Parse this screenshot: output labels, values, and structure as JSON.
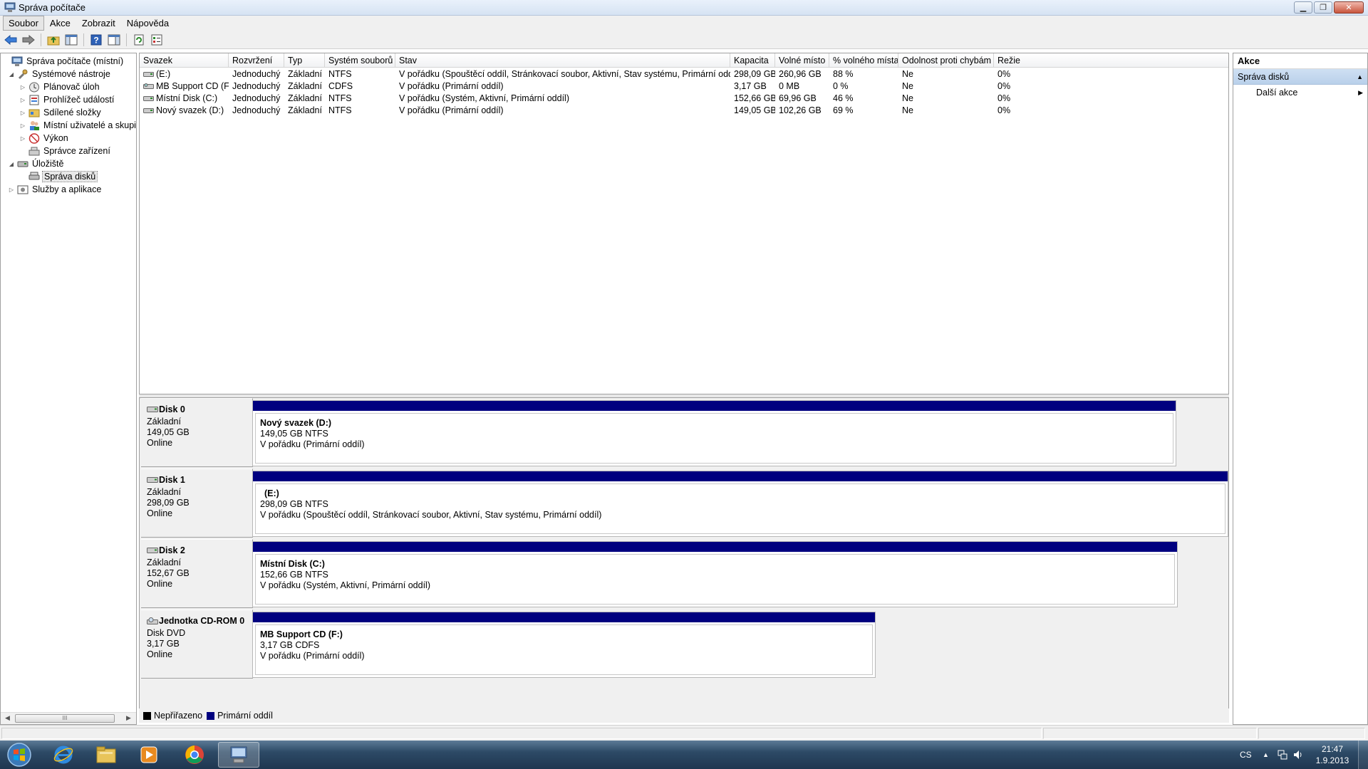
{
  "window": {
    "title": "Správa počítače",
    "minimize_icon": "minimize-icon",
    "restore_icon": "restore-icon",
    "close_icon": "close-icon"
  },
  "menu": {
    "items": [
      "Soubor",
      "Akce",
      "Zobrazit",
      "Nápověda"
    ],
    "active": "Soubor"
  },
  "toolbar": {
    "icons": [
      "back-arrow-icon",
      "forward-arrow-icon",
      "up-folder-icon",
      "show-hide-tree-icon",
      "help-icon",
      "show-hide-action-pane-icon",
      "refresh-icon",
      "properties-icon"
    ]
  },
  "tree": {
    "items": [
      {
        "label": "Správa počítače (místní)",
        "expander": "",
        "icon": "computer-management-icon"
      },
      {
        "label": "Systémové nástroje",
        "expander": "◢",
        "icon": "system-tools-icon"
      },
      {
        "label": "Plánovač úloh",
        "expander": "▷",
        "icon": "task-scheduler-icon"
      },
      {
        "label": "Prohlížeč událostí",
        "expander": "▷",
        "icon": "event-viewer-icon"
      },
      {
        "label": "Sdílené složky",
        "expander": "▷",
        "icon": "shared-folders-icon"
      },
      {
        "label": "Místní uživatelé a skupiny",
        "expander": "▷",
        "icon": "local-users-icon"
      },
      {
        "label": "Výkon",
        "expander": "▷",
        "icon": "performance-icon"
      },
      {
        "label": "Správce zařízení",
        "expander": "",
        "icon": "device-manager-icon"
      },
      {
        "label": "Úložiště",
        "expander": "◢",
        "icon": "storage-icon"
      },
      {
        "label": "Správa disků",
        "expander": "",
        "icon": "disk-management-icon",
        "selected": true
      },
      {
        "label": "Služby a aplikace",
        "expander": "▷",
        "icon": "services-applications-icon"
      }
    ],
    "scroll_left": "◀",
    "scroll_right": "▶",
    "scroll_grip": "III"
  },
  "volume_list": {
    "columns": [
      "Svazek",
      "Rozvržení",
      "Typ",
      "Systém souborů",
      "Stav",
      "Kapacita",
      "Volné místo",
      "% volného místa",
      "Odolnost proti chybám",
      "Režie"
    ],
    "rows": [
      {
        "volume": "(E:)",
        "icon": "hard-drive-icon",
        "layout": "Jednoduchý",
        "type": "Základní",
        "fs": "NTFS",
        "status": "V pořádku (Spouštěcí oddíl, Stránkovací soubor, Aktivní, Stav systému, Primární oddíl)",
        "capacity": "298,09 GB",
        "free": "260,96 GB",
        "pct_free": "88 %",
        "fault_tolerance": "Ne",
        "overhead": "0%"
      },
      {
        "volume": "MB Support CD (F:)",
        "icon": "cd-drive-icon",
        "layout": "Jednoduchý",
        "type": "Základní",
        "fs": "CDFS",
        "status": "V pořádku (Primární oddíl)",
        "capacity": "3,17 GB",
        "free": "0 MB",
        "pct_free": "0 %",
        "fault_tolerance": "Ne",
        "overhead": "0%"
      },
      {
        "volume": "Místní Disk (C:)",
        "icon": "hard-drive-icon",
        "layout": "Jednoduchý",
        "type": "Základní",
        "fs": "NTFS",
        "status": "V pořádku (Systém, Aktivní, Primární oddíl)",
        "capacity": "152,66 GB",
        "free": "69,96 GB",
        "pct_free": "46 %",
        "fault_tolerance": "Ne",
        "overhead": "0%"
      },
      {
        "volume": "Nový svazek (D:)",
        "icon": "hard-drive-icon",
        "layout": "Jednoduchý",
        "type": "Základní",
        "fs": "NTFS",
        "status": "V pořádku (Primární oddíl)",
        "capacity": "149,05 GB",
        "free": "102,26 GB",
        "pct_free": "69 %",
        "fault_tolerance": "Ne",
        "overhead": "0%"
      }
    ]
  },
  "disks": [
    {
      "name": "Disk 0",
      "icon": "hard-disk-icon",
      "kind": "Základní",
      "size": "149,05 GB",
      "state": "Online",
      "partition": {
        "title": "Nový svazek  (D:)",
        "size_fs": "149,05 GB NTFS",
        "status": "V pořádku (Primární oddíl)"
      }
    },
    {
      "name": "Disk 1",
      "icon": "hard-disk-icon",
      "kind": "Základní",
      "size": "298,09 GB",
      "state": "Online",
      "partition": {
        "title": "(E:)",
        "size_fs": "298,09 GB NTFS",
        "status": "V pořádku (Spouštěcí oddíl, Stránkovací soubor, Aktivní, Stav systému, Primární oddíl)"
      }
    },
    {
      "name": "Disk 2",
      "icon": "hard-disk-icon",
      "kind": "Základní",
      "size": "152,67 GB",
      "state": "Online",
      "partition": {
        "title": "Místní Disk  (C:)",
        "size_fs": "152,66 GB NTFS",
        "status": "V pořádku (Systém, Aktivní, Primární oddíl)"
      }
    },
    {
      "name": "Jednotka CD-ROM 0",
      "icon": "cd-rom-icon",
      "kind": "Disk DVD",
      "size": "3,17 GB",
      "state": "Online",
      "partition": {
        "title": "MB Support CD  (F:)",
        "size_fs": "3,17 GB CDFS",
        "status": "V pořádku (Primární oddíl)"
      }
    }
  ],
  "legend": {
    "items": [
      {
        "label": "Nepřiřazeno",
        "color": "#000000"
      },
      {
        "label": "Primární oddíl",
        "color": "#00007f"
      }
    ]
  },
  "action_pane": {
    "header": "Akce",
    "section": "Správa disků",
    "section_caret": "▲",
    "items": [
      {
        "label": "Další akce",
        "caret": "▶"
      }
    ]
  },
  "taskbar": {
    "apps": [
      "internet-explorer-icon",
      "windows-explorer-icon",
      "media-player-icon",
      "chrome-icon",
      "computer-management-taskbar-icon"
    ],
    "language": "CS",
    "tray_icons": [
      "show-hidden-icons-icon",
      "network-icon",
      "volume-icon"
    ],
    "tray_arrow": "▲",
    "time": "21:47",
    "date": "1.9.2013"
  },
  "colors": {
    "primary_partition": "#00007f",
    "unallocated": "#000000",
    "action_section": "#c4d8ef"
  }
}
